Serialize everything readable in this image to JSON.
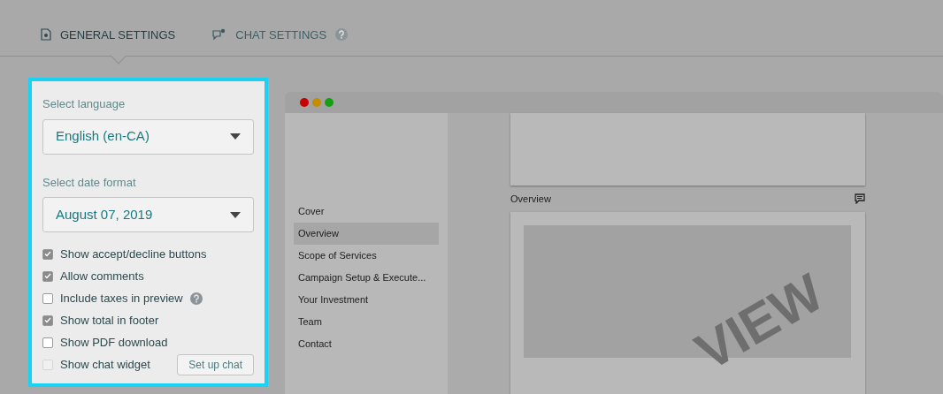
{
  "tabs": [
    {
      "label": "GENERAL SETTINGS",
      "selected": true,
      "kind": "document"
    },
    {
      "label": "CHAT SETTINGS",
      "selected": false,
      "kind": "chat",
      "help": true
    }
  ],
  "settings": {
    "language": {
      "label": "Select language",
      "value": "English (en-CA)"
    },
    "date_format": {
      "label": "Select date format",
      "value": "August 07, 2019"
    },
    "options": [
      {
        "label": "Show accept/decline buttons",
        "checked": true,
        "disabled": false
      },
      {
        "label": "Allow comments",
        "checked": true,
        "disabled": false
      },
      {
        "label": "Include taxes in preview",
        "checked": false,
        "disabled": false,
        "help": true
      },
      {
        "label": "Show total in footer",
        "checked": true,
        "disabled": false
      },
      {
        "label": "Show PDF download",
        "checked": false,
        "disabled": false
      },
      {
        "label": "Show chat widget",
        "checked": false,
        "disabled": true,
        "button": "Set up chat"
      }
    ]
  },
  "preview": {
    "nav": [
      {
        "label": "Cover",
        "selected": false
      },
      {
        "label": "Overview",
        "selected": true
      },
      {
        "label": "Scope of Services",
        "selected": false
      },
      {
        "label": "Campaign Setup & Execute...",
        "selected": false
      },
      {
        "label": "Your Investment",
        "selected": false
      },
      {
        "label": "Team",
        "selected": false
      },
      {
        "label": "Contact",
        "selected": false
      }
    ],
    "section_title": "Overview",
    "stamp": "VIEW"
  }
}
